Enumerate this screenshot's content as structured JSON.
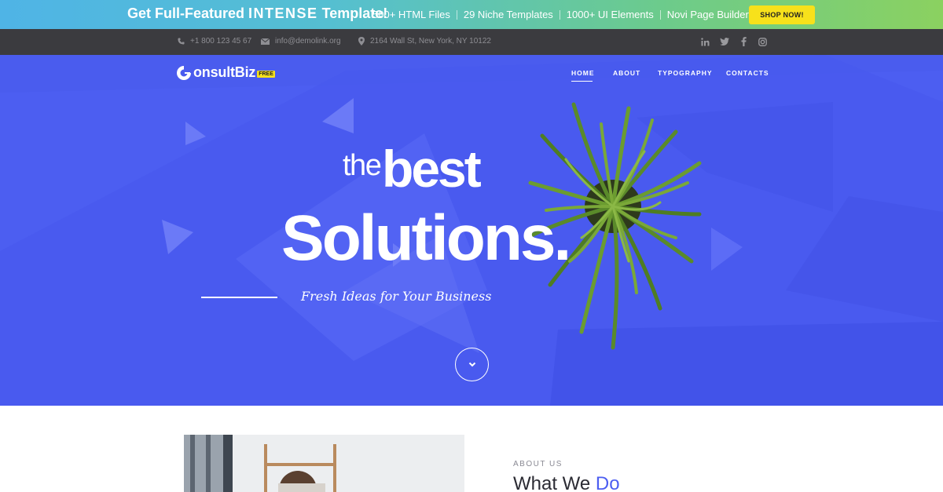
{
  "promo": {
    "title_prefix": "Get Full-Featured",
    "title_brand": "INTENSE",
    "title_suffix": "Template!",
    "features": [
      "500+ HTML Files",
      "29 Niche Templates",
      "1000+ UI Elements",
      "Novi Page Builder"
    ],
    "cta_label": "SHOP NOW!"
  },
  "topbar": {
    "phone": "+1 800 123 45 67",
    "email": "info@demolink.org",
    "address": "2164 Wall St, New York, NY 10122",
    "socials": [
      "linkedin-icon",
      "twitter-icon",
      "facebook-icon",
      "instagram-icon"
    ]
  },
  "header": {
    "logo_text": "onsultBiz",
    "logo_badge": "FREE",
    "nav": [
      "HOME",
      "ABOUT",
      "TYPOGRAPHY",
      "CONTACTS"
    ],
    "active_nav": "HOME"
  },
  "hero": {
    "line1_small": "the",
    "line1_big": "best",
    "line2": "Solutions.",
    "subtitle": "Fresh Ideas for Your Business"
  },
  "about": {
    "label": "ABOUT US",
    "title_main": "What We",
    "title_accent": "Do"
  },
  "colors": {
    "hero_bg": "#4c5ef1",
    "cta_yellow": "#f7e11b",
    "topbar_bg": "#3b3b3f"
  }
}
